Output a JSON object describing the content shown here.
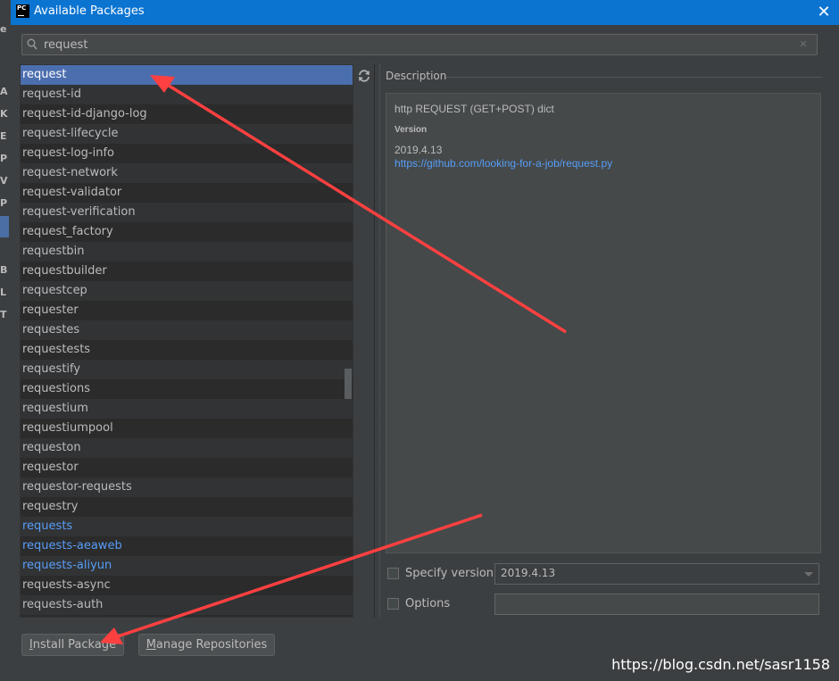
{
  "window": {
    "title": "Available Packages",
    "logo_text": "PC",
    "close_glyph": "✕"
  },
  "background_letters": [
    "e",
    "A",
    "K",
    "E",
    "P",
    "V",
    "P",
    "B",
    "L",
    "T"
  ],
  "search": {
    "value": "request",
    "clear_glyph": "✕"
  },
  "packages": [
    {
      "name": "request",
      "selected": true,
      "installed": false
    },
    {
      "name": "request-id",
      "selected": false,
      "installed": false
    },
    {
      "name": "request-id-django-log",
      "selected": false,
      "installed": false
    },
    {
      "name": "request-lifecycle",
      "selected": false,
      "installed": false
    },
    {
      "name": "request-log-info",
      "selected": false,
      "installed": false
    },
    {
      "name": "request-network",
      "selected": false,
      "installed": false
    },
    {
      "name": "request-validator",
      "selected": false,
      "installed": false
    },
    {
      "name": "request-verification",
      "selected": false,
      "installed": false
    },
    {
      "name": "request_factory",
      "selected": false,
      "installed": false
    },
    {
      "name": "requestbin",
      "selected": false,
      "installed": false
    },
    {
      "name": "requestbuilder",
      "selected": false,
      "installed": false
    },
    {
      "name": "requestcep",
      "selected": false,
      "installed": false
    },
    {
      "name": "requester",
      "selected": false,
      "installed": false
    },
    {
      "name": "requestes",
      "selected": false,
      "installed": false
    },
    {
      "name": "requestests",
      "selected": false,
      "installed": false
    },
    {
      "name": "requestify",
      "selected": false,
      "installed": false
    },
    {
      "name": "requestions",
      "selected": false,
      "installed": false
    },
    {
      "name": "requestium",
      "selected": false,
      "installed": false
    },
    {
      "name": "requestiumpool",
      "selected": false,
      "installed": false
    },
    {
      "name": "requeston",
      "selected": false,
      "installed": false
    },
    {
      "name": "requestor",
      "selected": false,
      "installed": false
    },
    {
      "name": "requestor-requests",
      "selected": false,
      "installed": false
    },
    {
      "name": "requestry",
      "selected": false,
      "installed": false
    },
    {
      "name": "requests",
      "selected": false,
      "installed": true
    },
    {
      "name": "requests-aeaweb",
      "selected": false,
      "installed": true
    },
    {
      "name": "requests-aliyun",
      "selected": false,
      "installed": true
    },
    {
      "name": "requests-async",
      "selected": false,
      "installed": false
    },
    {
      "name": "requests-auth",
      "selected": false,
      "installed": false
    }
  ],
  "description": {
    "label": "Description",
    "summary": "http REQUEST (GET+POST) dict",
    "version_heading": "Version",
    "version": "2019.4.13",
    "url": "https://github.com/looking-for-a-job/request.py"
  },
  "options": {
    "specify_version_label": "Specify version",
    "specify_version_checked": false,
    "version_value": "2019.4.13",
    "options_label": "Options",
    "options_checked": false,
    "options_value": ""
  },
  "buttons": {
    "install_prefix": "",
    "install_mnemonic": "I",
    "install_rest": "nstall Package",
    "manage_prefix": "",
    "manage_mnemonic": "M",
    "manage_rest": "anage Repositories"
  },
  "watermark": "https://blog.csdn.net/sasr1158",
  "colors": {
    "titlebar": "#0b74d1",
    "selection": "#4b6eaf",
    "installed_text": "#589df6",
    "annotation_arrow": "#ff4040"
  }
}
